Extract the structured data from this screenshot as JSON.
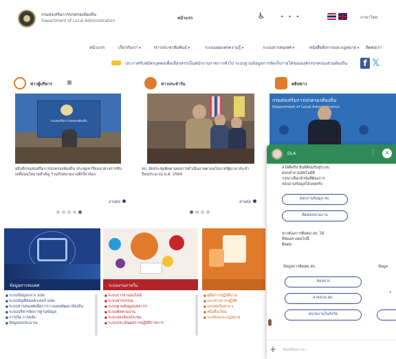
{
  "header": {
    "org_name_th": "กรมส่งเสริมการปกครองท้องถิ่น",
    "org_name_en": "Department of Local Administration",
    "center_link": "หน้าแรก",
    "access_icon": "accessibility-icon",
    "dots": "• • •",
    "lang_label": "ภาษาไทย"
  },
  "nav": {
    "items": [
      "หน้าแรก",
      "เกี่ยวกับเรา",
      "ข่าวประชาสัมพันธ์",
      "ระบบเผยแพร่ความรู้",
      "ระบบสารสนเทศ",
      "หนังสือสั่งการและกฎหมาย",
      "ติดต่อเรา"
    ]
  },
  "ticker": {
    "text": "ประกาศรับสมัครบุคคลเพื่อเลือกสรรเป็นพนักงานราชการทั่วไป        ระบบฐานข้อมูลการจัดเก็บรายได้ขององค์กรปกครองส่วนท้องถิ่น"
  },
  "social": {
    "facebook": "f",
    "twitter": "𝕏"
  },
  "news": {
    "col1": {
      "title": "ข่าวผู้บริหาร",
      "caption": "อธิบดีกรมส่งเสริมการปกครองท้องถิ่น ประชุมหารือแนวทางการขับเคลื่อนนโยบายสำคัญ ร่วมกับหน่วยงานที่เกี่ยวข้อง",
      "read_more": "อ่านต่อ",
      "photo_sign": "กรมส่งเสริมการปกครองท้องถิ่น"
    },
    "col2": {
      "title": "ข่าวประจำวัน",
      "caption": "สถ. จัดประชุมติดตามผลการดำเนินงานตามนโยบายรัฐบาล ประจำปีงบประมาณ พ.ศ. 2564",
      "read_more": "อ่านต่อ"
    },
    "col3": {
      "title": "คลิปข่าว",
      "banner_th": "กรมส่งเสริมการปกครองท้องถิ่น",
      "banner_en": "Department of Local Administration"
    }
  },
  "tiles": [
    {
      "title": "ข้อมูลสารสนเทศ",
      "color": "#1f3f86",
      "items": [
        "ระบบข้อมูลกลาง อปท.",
        "ระบบบัญชีคอมพิวเตอร์ อปท.",
        "ระบบสารสนเทศเพื่อการวางแผนพัฒนาท้องถิ่น",
        "ระบบบริหารจัดการฐานข้อมูล",
        "การเงิน การคลัง",
        "ข้อมูลงบประมาณ"
      ]
    },
    {
      "title": "ระบบงานภายใน",
      "color": "#b3242a",
      "items": [
        "ระบบการลาออนไลน์",
        "ระบบสารบรรณ",
        "ระบบฐานข้อมูลบุคลากร",
        "ระบบติดตามงาน",
        "ระบบจองห้องประชุม",
        "ระบบประเมินผลการปฏิบัติราชการ"
      ]
    },
    {
      "title": "",
      "color": "#e07b2c",
      "items": [
        "คู่มือการปฏิบัติงาน",
        "แนวทางการปฏิบัติ",
        "แบบฟอร์มต่าง ๆ",
        "หนังสือเวียน",
        "ระเบียบและกฎหมาย"
      ]
    }
  ],
  "chat": {
    "title": "DLA",
    "intro": [
      "สวัสดีครับ ยินดีต้อนรับสู่ระบบ",
      "ตอบคำถามอัตโนมัติ",
      "กรุณาเลือกหัวข้อที่ต้องการ",
      "สอบถามข้อมูลได้เลยครับ"
    ],
    "btn1": "สอบถามข้อมูล สถ.",
    "btn2": "ติดต่อหน่วยงาน",
    "msg2": [
      "หากต้องการติดต่อ สถ. ได้",
      "ที่ช่องทางต่อไปนี้",
      "ติดต่อ"
    ],
    "section_label": "ข้อมูลการติดต่อ สถ.",
    "section_label2": "ข้อมูล",
    "btn3": "ช่องทาง",
    "btn4": "สายด่วน สถ.",
    "btn5": "หน่วยงานในสังกัด",
    "placeholder": "พิมพ์ข้อความ..."
  }
}
